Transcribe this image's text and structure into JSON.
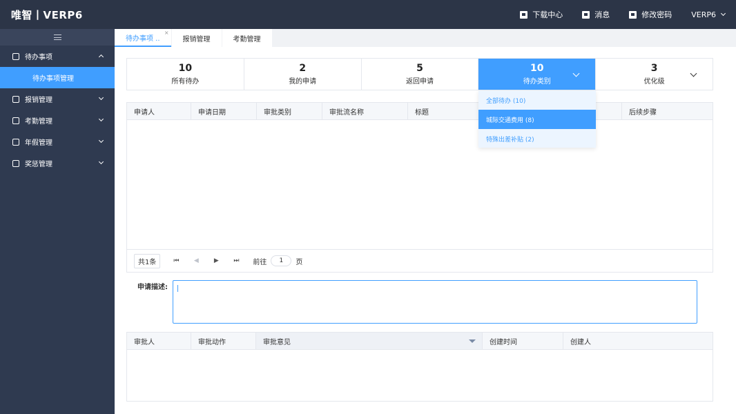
{
  "header": {
    "logo": "唯智丨VERP6",
    "actions": [
      {
        "icon": "download-icon",
        "label": "下载中心"
      },
      {
        "icon": "message-icon",
        "label": "消息"
      },
      {
        "icon": "edit-icon",
        "label": "修改密码"
      }
    ],
    "user": "VERP6"
  },
  "sidebar": {
    "items": [
      {
        "label": "待办事项",
        "icon": "todo-icon",
        "expanded": true
      },
      {
        "label": "待办事项管理",
        "sub": true
      },
      {
        "label": "报销管理",
        "icon": "reimburse-icon"
      },
      {
        "label": "考勤管理",
        "icon": "attendance-icon"
      },
      {
        "label": "年假管理",
        "icon": "leave-icon"
      },
      {
        "label": "奖惩管理",
        "icon": "reward-icon"
      }
    ]
  },
  "tabs": [
    {
      "label": "待办事项 ..",
      "active": true
    },
    {
      "label": "报销管理"
    },
    {
      "label": "考勤管理"
    }
  ],
  "stats": [
    {
      "num": "10",
      "label": "所有待办"
    },
    {
      "num": "2",
      "label": "我的申请"
    },
    {
      "num": "5",
      "label": "返回申请"
    },
    {
      "num": "10",
      "label": "待办类别",
      "active": true
    },
    {
      "num": "3",
      "label": "优化级"
    }
  ],
  "dropdown": [
    "全部待办 (10)",
    "城际交通费用 (8)",
    "特殊出差补贴 (2)"
  ],
  "table1": {
    "columns": [
      "申请人",
      "申请日期",
      "审批类别",
      "审批流名称",
      "标题",
      "",
      "",
      "后续步骤"
    ]
  },
  "pager": {
    "total": "共1条",
    "goto": "前往",
    "page": "1",
    "page_unit": "页"
  },
  "description": {
    "label": "申请描述:"
  },
  "table2": {
    "columns": [
      "审批人",
      "审批动作",
      "审批意见",
      "创建时间",
      "创建人"
    ]
  },
  "colors": {
    "accent": "#409eff",
    "header_bg": "#2c3547",
    "sidebar_bg": "#2f3a50"
  }
}
